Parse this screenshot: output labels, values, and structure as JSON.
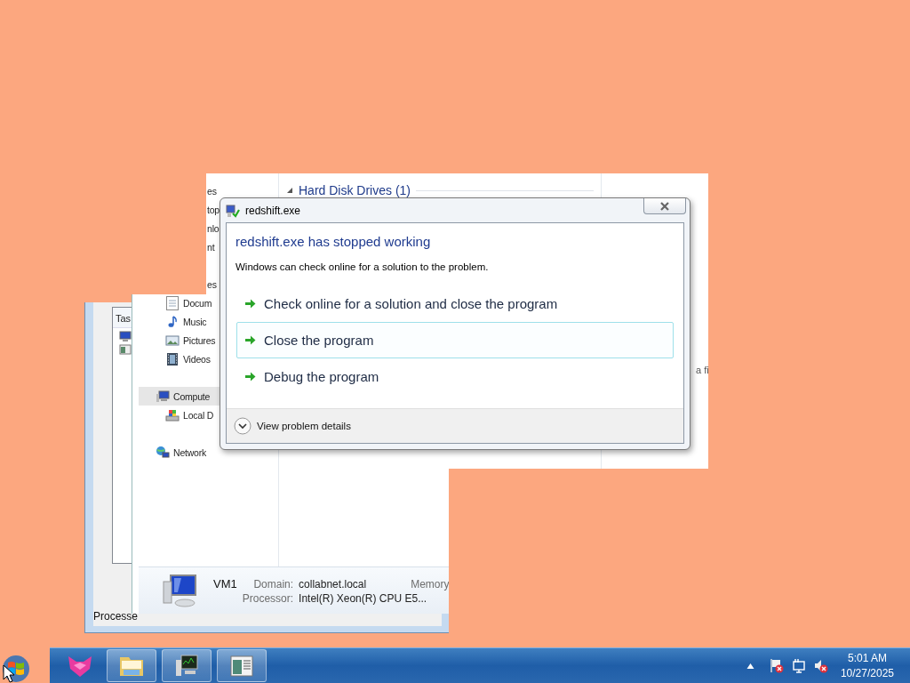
{
  "task_manager": {
    "column_fragment": "Tas",
    "status_fragment": "Processe"
  },
  "explorer": {
    "nav_groups": [
      {
        "label": "es",
        "kind": "fragment",
        "selected": false,
        "children": [
          {
            "label": "top",
            "kind": "fragment",
            "selected": false
          },
          {
            "label": "nlo",
            "kind": "fragment",
            "selected": false
          },
          {
            "label": "nt",
            "kind": "fragment",
            "selected": false
          }
        ]
      },
      {
        "label": "es",
        "kind": "fragment",
        "selected": false,
        "children": [
          {
            "label": "Docum",
            "kind": "documents",
            "selected": false
          },
          {
            "label": "Music",
            "kind": "music",
            "selected": false
          },
          {
            "label": "Pictures",
            "kind": "pictures",
            "selected": false
          },
          {
            "label": "Videos",
            "kind": "videos",
            "selected": false
          }
        ]
      },
      {
        "label": "Compute",
        "kind": "computer",
        "selected": true,
        "children": [
          {
            "label": "Local D",
            "kind": "drive",
            "selected": false
          }
        ]
      },
      {
        "label": "Network",
        "kind": "network",
        "selected": false
      }
    ],
    "group_header": {
      "label": "Hard Disk Drives (1)",
      "expanded": true
    },
    "details_pane_fragment": "a fi",
    "details": {
      "name": "VM1",
      "domain_label": "Domain:",
      "domain": "collabnet.local",
      "memory_label": "Memory",
      "processor_label": "Processor:",
      "processor": "Intel(R) Xeon(R) CPU E5..."
    }
  },
  "dialog": {
    "title": "redshift.exe",
    "heading": "redshift.exe has stopped working",
    "message": "Windows can check online for a solution to the problem.",
    "options": [
      {
        "label": "Check online for a solution and close the program",
        "selected": false
      },
      {
        "label": "Close the program",
        "selected": true
      },
      {
        "label": "Debug the program",
        "selected": false
      }
    ],
    "details_toggle": "View problem details"
  },
  "taskbar": {
    "time": "5:01 AM",
    "date": "10/27/2025"
  }
}
